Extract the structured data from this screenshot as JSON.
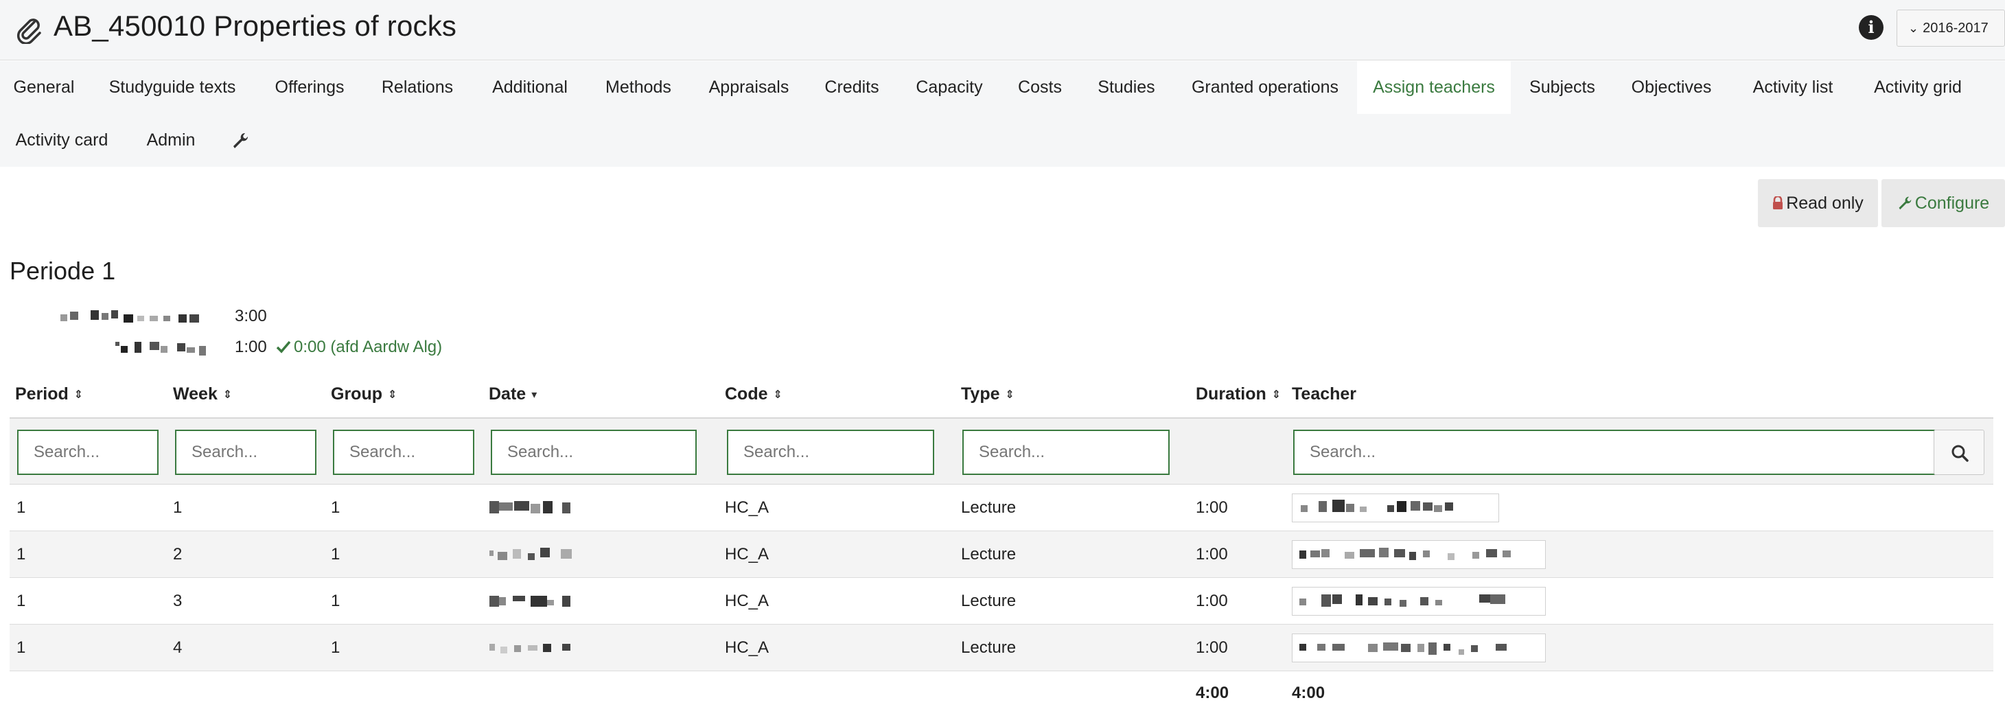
{
  "header": {
    "title": "AB_450010 Properties of rocks",
    "year_selector": "2016-2017"
  },
  "tabs": [
    {
      "label": "General",
      "active": false
    },
    {
      "label": "Studyguide texts",
      "active": false
    },
    {
      "label": "Offerings",
      "active": false
    },
    {
      "label": "Relations",
      "active": false
    },
    {
      "label": "Additional",
      "active": false
    },
    {
      "label": "Methods",
      "active": false
    },
    {
      "label": "Appraisals",
      "active": false
    },
    {
      "label": "Credits",
      "active": false
    },
    {
      "label": "Capacity",
      "active": false
    },
    {
      "label": "Costs",
      "active": false
    },
    {
      "label": "Studies",
      "active": false
    },
    {
      "label": "Granted operations",
      "active": false
    },
    {
      "label": "Assign teachers",
      "active": true
    },
    {
      "label": "Subjects",
      "active": false
    },
    {
      "label": "Objectives",
      "active": false
    },
    {
      "label": "Activity list",
      "active": false
    },
    {
      "label": "Activity grid",
      "active": false
    },
    {
      "label": "Activity card",
      "active": false
    },
    {
      "label": "Admin",
      "active": false
    }
  ],
  "actions": {
    "read_only": "Read only",
    "configure": "Configure"
  },
  "period": {
    "title": "Periode 1",
    "summary": [
      {
        "value": "3:00",
        "note": ""
      },
      {
        "value": "1:00",
        "note": "0:00 (afd Aardw Alg)"
      }
    ]
  },
  "table": {
    "columns": [
      "Period",
      "Week",
      "Group",
      "Date",
      "Code",
      "Type",
      "Duration",
      "Teacher"
    ],
    "search_placeholder": "Search...",
    "rows": [
      {
        "period": "1",
        "week": "1",
        "group": "1",
        "code": "HC_A",
        "type": "Lecture",
        "duration": "1:00"
      },
      {
        "period": "1",
        "week": "2",
        "group": "1",
        "code": "HC_A",
        "type": "Lecture",
        "duration": "1:00"
      },
      {
        "period": "1",
        "week": "3",
        "group": "1",
        "code": "HC_A",
        "type": "Lecture",
        "duration": "1:00"
      },
      {
        "period": "1",
        "week": "4",
        "group": "1",
        "code": "HC_A",
        "type": "Lecture",
        "duration": "1:00"
      }
    ],
    "totals": {
      "duration": "4:00",
      "teacher": "4:00"
    }
  },
  "colors": {
    "accent_green": "#3a7a3f",
    "lock_red": "#c0504d",
    "header_bg": "#f5f6f7"
  },
  "icons": [
    "paperclip-icon",
    "info-icon",
    "chevron-down-icon",
    "wrench-icon",
    "lock-icon",
    "check-icon",
    "sort-icon",
    "search-icon"
  ]
}
